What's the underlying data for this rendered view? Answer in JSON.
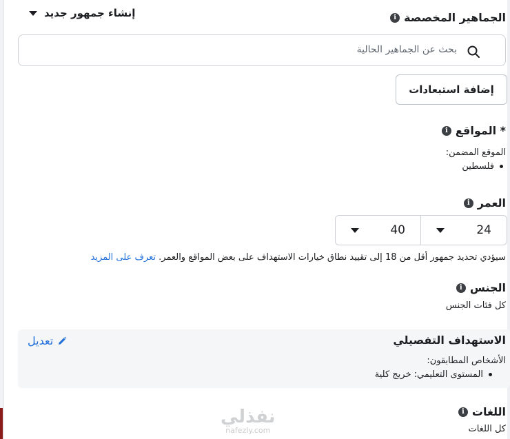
{
  "custom_audiences": {
    "title": "الجماهير المخصصة",
    "create_label": "إنشاء جمهور جديد",
    "search_placeholder": "بحث عن الجماهير الحالية",
    "add_exclusions_label": "إضافة استبعادات"
  },
  "locations": {
    "title": "* المواقع",
    "included_label": "الموقع المضمن:",
    "items": [
      "فلسطين"
    ]
  },
  "age": {
    "title": "العمر",
    "min": "24",
    "max": "40",
    "note": "سيؤدي تحديد جمهور أقل من 18 إلى تقييد نطاق خيارات الاستهداف على بعض المواقع والعمر.",
    "learn_more": "تعرف على المزيد"
  },
  "gender": {
    "title": "الجنس",
    "value": "كل فئات الجنس"
  },
  "detailed_targeting": {
    "title": "الاستهداف التفصيلي",
    "edit_label": "تعديل",
    "matching_label": "الأشخاص المطابقون:",
    "items": [
      "المستوى التعليمي: خريج كلية"
    ]
  },
  "languages": {
    "title": "اللغات",
    "value": "كل اللغات"
  },
  "watermark": {
    "ar": "نفذلي",
    "en": "nafezly.com"
  }
}
